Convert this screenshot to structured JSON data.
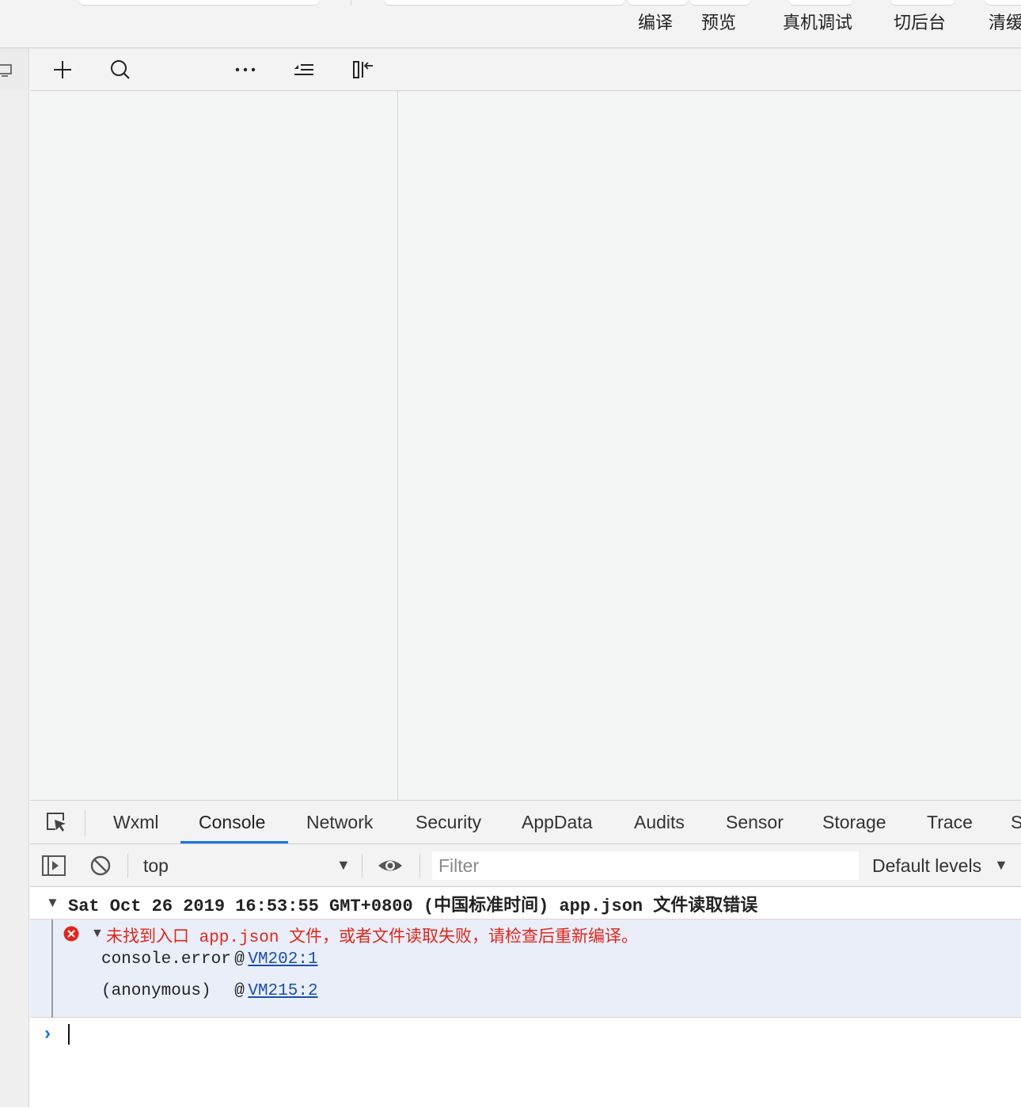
{
  "toolbar": {
    "compile_label": "编译",
    "preview_label": "预览",
    "remote_debug_label": "真机调试",
    "background_label": "切后台",
    "clear_cache_label": "清缓"
  },
  "devtools": {
    "tabs": [
      "Wxml",
      "Console",
      "Network",
      "Security",
      "AppData",
      "Audits",
      "Sensor",
      "Storage",
      "Trace",
      "S"
    ],
    "active_tab": "Console",
    "context_select": "top",
    "filter_placeholder": "Filter",
    "levels_label": "Default levels"
  },
  "console": {
    "group_header": "Sat Oct 26 2019 16:53:55 GMT+0800 (中国标准时间)  app.json 文件读取错误",
    "error_message": "未找到入口 app.json 文件，或者文件读取失败，请检查后重新编译。",
    "stack": [
      {
        "fn": "console.error",
        "at": "@",
        "link": "VM202:1"
      },
      {
        "fn": "(anonymous)  ",
        "at": "@",
        "link": "VM215:2"
      }
    ]
  },
  "colors": {
    "accent": "#1a73e8",
    "error_text": "#e0261e",
    "error_bg": "#e9eef8",
    "link": "#1a4fa8"
  }
}
